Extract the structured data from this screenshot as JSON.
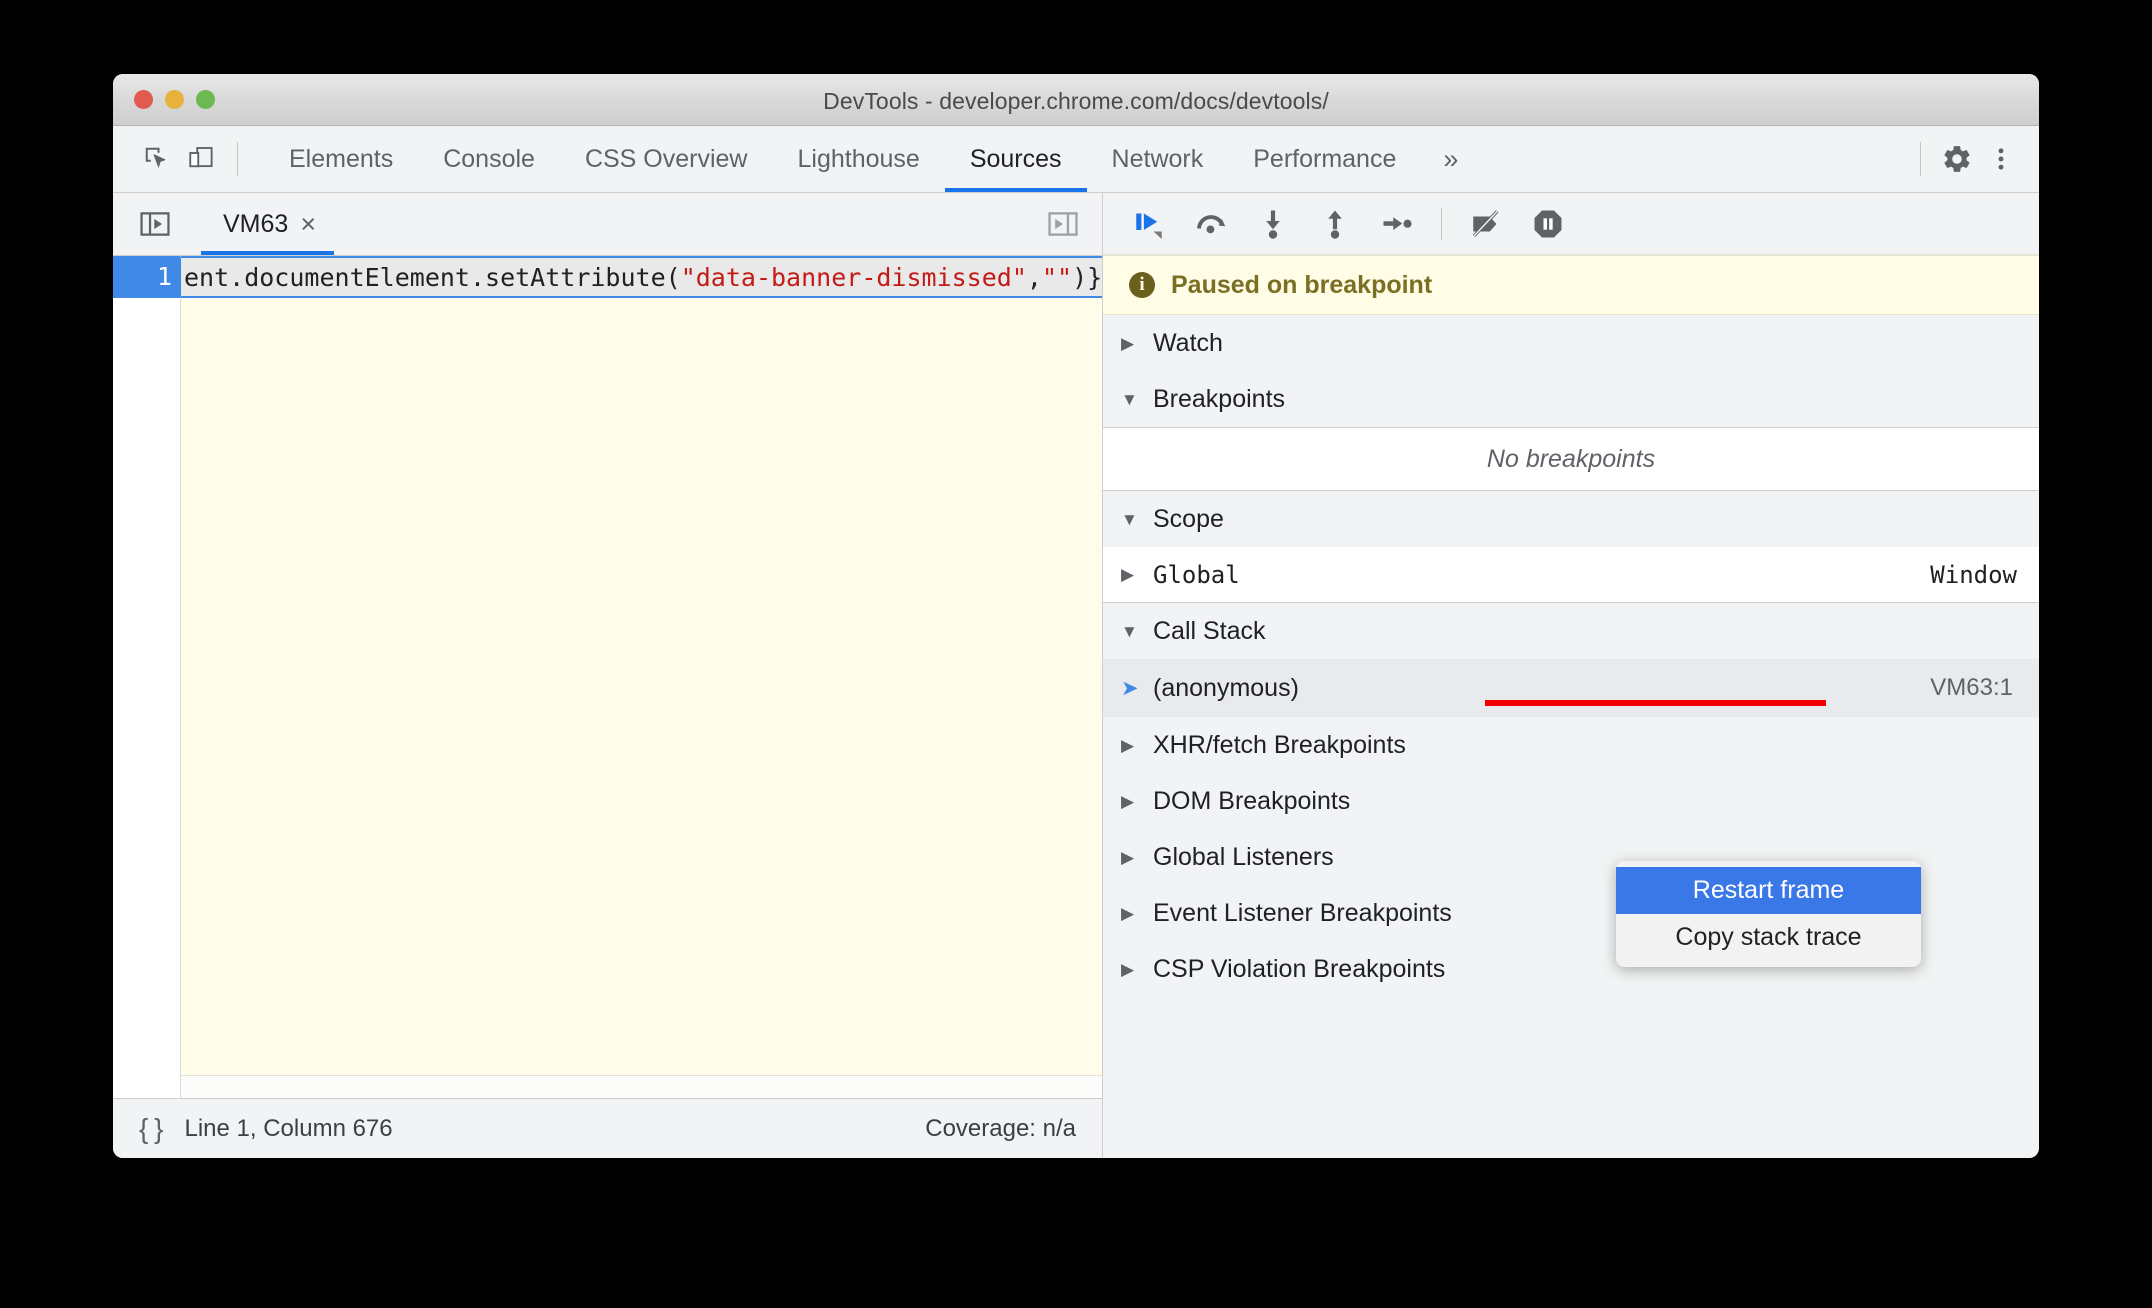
{
  "window": {
    "title": "DevTools - developer.chrome.com/docs/devtools/",
    "traffic": {
      "close": "close-button",
      "minimize": "minimize-button",
      "zoom": "zoom-button"
    }
  },
  "toolbar": {
    "inspect_icon": "inspect-element-icon",
    "device_icon": "device-toolbar-icon",
    "settings_icon": "gear-icon",
    "more_icon": "more-vertical-icon",
    "tabs": [
      {
        "label": "Elements",
        "active": false
      },
      {
        "label": "Console",
        "active": false
      },
      {
        "label": "CSS Overview",
        "active": false
      },
      {
        "label": "Lighthouse",
        "active": false
      },
      {
        "label": "Sources",
        "active": true
      },
      {
        "label": "Network",
        "active": false
      },
      {
        "label": "Performance",
        "active": false
      }
    ],
    "more_tabs_label": "»"
  },
  "editor": {
    "navigator_toggle_icon": "show-navigator-icon",
    "debugger_toggle_icon": "show-debugger-icon",
    "file_tab": {
      "name": "VM63",
      "close_label": "×"
    },
    "line_number": "1",
    "code": {
      "prefix": "ent.documentElement.setAttribute(",
      "string1": "\"data-banner-dismissed\"",
      "comma": ",",
      "string2": "\"\"",
      "suffix": ")}"
    }
  },
  "statusbar": {
    "format_icon": "pretty-print-braces-icon",
    "position": "Line 1, Column 676",
    "coverage": "Coverage: n/a"
  },
  "debugger": {
    "toolbar": [
      {
        "name": "resume-script-execution-button",
        "icon": "resume-icon",
        "active": true
      },
      {
        "name": "step-over-button",
        "icon": "step-over-icon",
        "active": false
      },
      {
        "name": "step-into-button",
        "icon": "step-into-icon",
        "active": false
      },
      {
        "name": "step-out-button",
        "icon": "step-out-icon",
        "active": false
      },
      {
        "name": "step-button",
        "icon": "step-icon",
        "active": false
      },
      {
        "name": "deactivate-breakpoints-button",
        "icon": "deactivate-breakpoints-icon",
        "active": false
      },
      {
        "name": "pause-on-exceptions-button",
        "icon": "pause-on-exceptions-icon",
        "active": false
      }
    ],
    "banner": {
      "icon": "info-icon",
      "text": "Paused on breakpoint"
    },
    "sections": {
      "watch": {
        "label": "Watch",
        "expanded": false
      },
      "breakpoints": {
        "label": "Breakpoints",
        "expanded": true,
        "empty_text": "No breakpoints"
      },
      "scope": {
        "label": "Scope",
        "expanded": true
      },
      "scope_rows": [
        {
          "name": "Global",
          "value": "Window"
        }
      ],
      "call_stack": {
        "label": "Call Stack",
        "expanded": true
      },
      "frames": [
        {
          "name": "(anonymous)",
          "location": "VM63:1"
        }
      ],
      "others": [
        {
          "label": "XHR/fetch Breakpoints",
          "expanded": false
        },
        {
          "label": "DOM Breakpoints",
          "expanded": false
        },
        {
          "label": "Global Listeners",
          "expanded": false
        },
        {
          "label": "Event Listener Breakpoints",
          "expanded": false
        },
        {
          "label": "CSP Violation Breakpoints",
          "expanded": false
        }
      ]
    }
  },
  "context_menu": {
    "items": [
      {
        "label": "Restart frame",
        "selected": true,
        "struck_out": true
      },
      {
        "label": "Copy stack trace",
        "selected": false
      }
    ]
  },
  "colors": {
    "accent_blue": "#1a73e8",
    "selected_blue": "#3b78e7",
    "strike_red": "#f20000",
    "paused_banner_bg": "#fffde6",
    "paused_banner_text": "#7a6f22",
    "editor_bg": "#fffdea",
    "code_string": "#c41a16",
    "chrome_bg": "#f1f3f4"
  },
  "triangles": {
    "collapsed": "▶",
    "expanded": "▼",
    "frame": "➤"
  }
}
